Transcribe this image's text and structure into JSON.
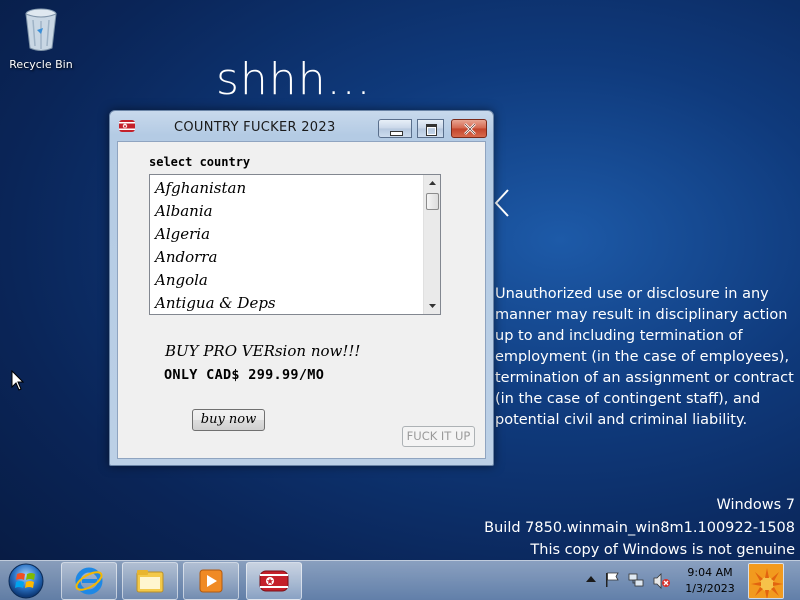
{
  "desktop": {
    "icons": [
      {
        "label": "Recycle Bin",
        "icon": "recycle-bin-icon"
      }
    ],
    "heading": "shhh...",
    "warning_text": "Unauthorized use or disclosure in any manner may result in disciplinary action up to and including termination of employment (in the case of employees), termination of an assignment or contract (in the case of contingent staff), and potential civil and criminal liability.",
    "watermark": {
      "line1": "Windows 7",
      "line2": "Build 7850.winmain_win8m1.100922-1508",
      "line3": "This copy of Windows is not genuine"
    }
  },
  "window": {
    "title": "COUNTRY FUCKER 2023",
    "select_label": "select country",
    "countries": [
      "Afghanistan",
      "Albania",
      "Algeria",
      "Andorra",
      "Angola",
      "Antigua & Deps"
    ],
    "promo_line1": "BUY PRO VERsion now!!!",
    "promo_line2": "ONLY CAD$ 299.99/MO",
    "buy_button": "buy now",
    "action_button": "FUCK IT UP"
  },
  "taskbar": {
    "time": "9:04 AM",
    "date": "1/3/2023",
    "apps": [
      "internet-explorer-icon",
      "file-explorer-icon",
      "media-player-icon",
      "country-app-icon"
    ],
    "tray_icons": [
      "chevron-up-icon",
      "flag-icon",
      "network-icon",
      "volume-muted-icon"
    ]
  },
  "colors": {
    "desktop_bg": "#0f3a7c",
    "close_button": "#c2432a",
    "window_frame": "#b4cbe4"
  }
}
